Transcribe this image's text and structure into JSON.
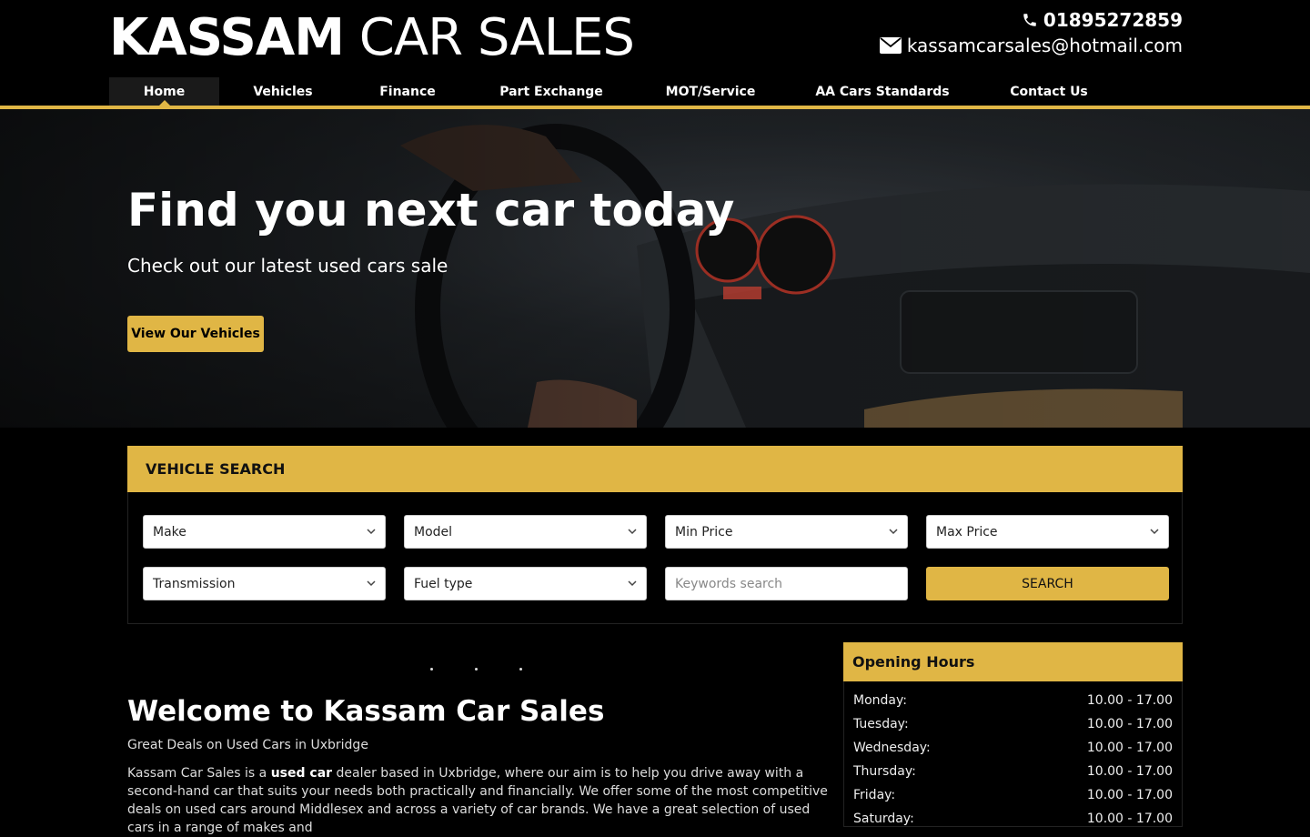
{
  "brand": {
    "name_bold": "KASSAM",
    "name_light": "CAR SALES"
  },
  "contact": {
    "phone": "01895272859",
    "email": "kassamcarsales@hotmail.com"
  },
  "nav": {
    "items": [
      {
        "label": "Home"
      },
      {
        "label": "Vehicles"
      },
      {
        "label": "Finance"
      },
      {
        "label": "Part Exchange"
      },
      {
        "label": "MOT/Service"
      },
      {
        "label": "AA Cars Standards"
      },
      {
        "label": "Contact Us"
      }
    ]
  },
  "hero": {
    "title": "Find you next car today",
    "subtitle": "Check out our latest used cars sale",
    "button": "View Our Vehicles"
  },
  "search": {
    "heading": "VEHICLE SEARCH",
    "make": "Make",
    "model": "Model",
    "min_price": "Min Price",
    "max_price": "Max Price",
    "transmission": "Transmission",
    "fuel_type": "Fuel type",
    "keywords_placeholder": "Keywords search",
    "button": "SEARCH"
  },
  "welcome": {
    "title": "Welcome to Kassam Car Sales",
    "subtitle": "Great Deals on Used Cars in Uxbridge",
    "text_1": "Kassam Car Sales is a ",
    "text_bold": "used car",
    "text_2": " dealer based in Uxbridge, where our aim is to help you drive away with a second-hand car that suits your needs both practically and financially. We offer some of the most competitive deals on used cars around Middlesex and across a variety of car brands. We have a great selection of used cars in a range of makes and"
  },
  "hours": {
    "heading": "Opening Hours",
    "rows": [
      {
        "day": "Monday:",
        "time": "10.00 - 17.00"
      },
      {
        "day": "Tuesday:",
        "time": "10.00 - 17.00"
      },
      {
        "day": "Wednesday:",
        "time": "10.00 - 17.00"
      },
      {
        "day": "Thursday:",
        "time": "10.00 - 17.00"
      },
      {
        "day": "Friday:",
        "time": "10.00 - 17.00"
      },
      {
        "day": "Saturday:",
        "time": "10.00 - 17.00"
      }
    ]
  },
  "colors": {
    "accent": "#e0b645",
    "background": "#000000"
  }
}
